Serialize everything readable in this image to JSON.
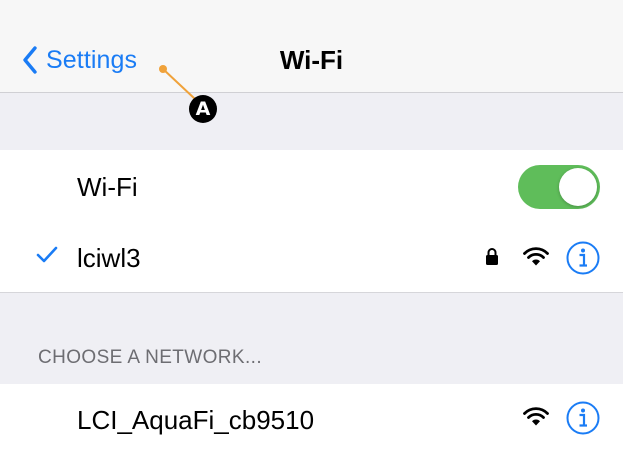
{
  "navbar": {
    "back_label": "Settings",
    "title": "Wi-Fi"
  },
  "annotation": {
    "badge": "A"
  },
  "wifi_toggle": {
    "label": "Wi-Fi",
    "on": true
  },
  "current_network": {
    "name": "lciwl3",
    "connected": true,
    "secured": true
  },
  "choose_section": {
    "header": "CHOOSE A NETWORK..."
  },
  "networks": [
    {
      "name": "LCI_AquaFi_cb9510",
      "secured": false
    }
  ],
  "colors": {
    "accent": "#1a7cf5",
    "toggle_on": "#5fbd5a",
    "callout": "#f0a23a"
  },
  "icons": {
    "back": "chevron-left-icon",
    "check": "checkmark-icon",
    "lock": "lock-icon",
    "wifi": "wifi-icon",
    "info": "info-icon"
  }
}
